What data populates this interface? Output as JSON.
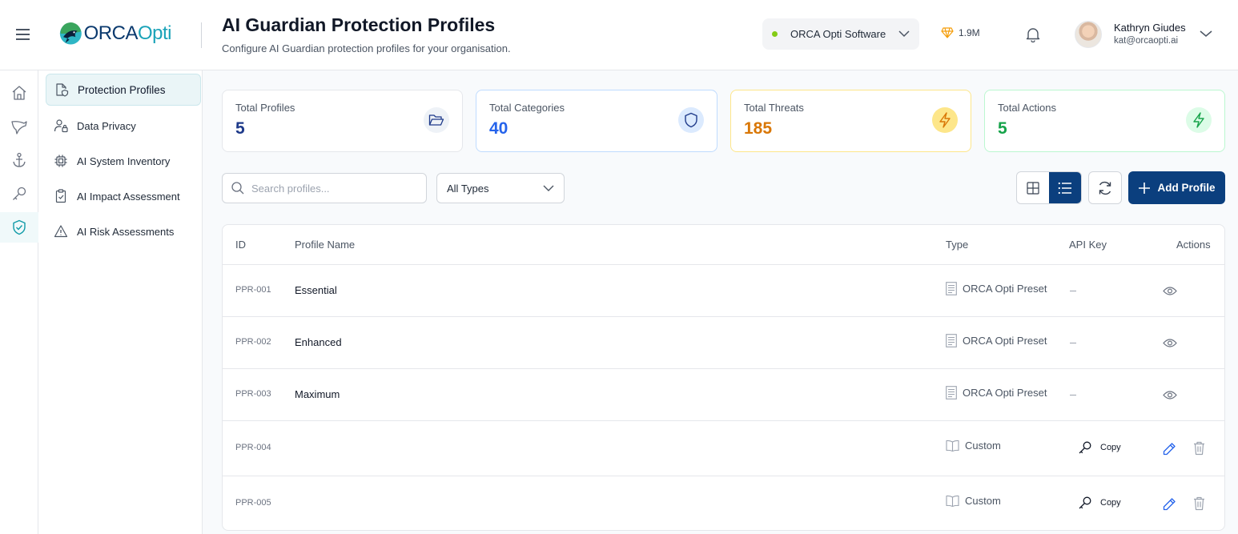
{
  "header": {
    "logo": {
      "part1": "ORCA",
      "part2": "Opti"
    },
    "title": "AI Guardian Protection Profiles",
    "subtitle": "Configure AI Guardian protection profiles for your organisation.",
    "org": {
      "name": "ORCA Opti Software",
      "status_color": "#84cc16"
    },
    "credits": "1.9M",
    "user": {
      "name": "Kathryn Giudes",
      "email": "kat@orcaopti.ai"
    }
  },
  "rail": {
    "items": [
      {
        "icon": "home-icon"
      },
      {
        "icon": "orca-icon"
      },
      {
        "icon": "anchor-icon"
      },
      {
        "icon": "key-icon"
      },
      {
        "icon": "shield-check-icon",
        "active": true
      }
    ]
  },
  "sidenav": {
    "items": [
      {
        "label": "Protection Profiles",
        "icon": "file-shield-icon",
        "active": true
      },
      {
        "label": "Data Privacy",
        "icon": "user-lock-icon"
      },
      {
        "label": "AI System Inventory",
        "icon": "chip-icon"
      },
      {
        "label": "AI Impact Assessment",
        "icon": "clipboard-check-icon"
      },
      {
        "label": "AI Risk Assessments",
        "icon": "warning-icon"
      }
    ]
  },
  "stats": [
    {
      "label": "Total Profiles",
      "value": "5",
      "color": "#1e3a8a",
      "icon": "folder-open-icon"
    },
    {
      "label": "Total Categories",
      "value": "40",
      "color": "#2563eb",
      "icon": "shield-icon"
    },
    {
      "label": "Total Threats",
      "value": "185",
      "color": "#d97706",
      "icon": "bolt-icon"
    },
    {
      "label": "Total Actions",
      "value": "5",
      "color": "#16a34a",
      "icon": "bolt-icon"
    }
  ],
  "toolbar": {
    "search_placeholder": "Search profiles...",
    "type_filter": "All Types",
    "add_label": "Add Profile"
  },
  "table": {
    "columns": {
      "id": "ID",
      "name": "Profile Name",
      "type": "Type",
      "api_key": "API Key",
      "actions": "Actions"
    },
    "rows": [
      {
        "id": "PPR-001",
        "name": "Essential",
        "type": "ORCA Opti Preset",
        "api_key": "",
        "editable": false
      },
      {
        "id": "PPR-002",
        "name": "Enhanced",
        "type": "ORCA Opti Preset",
        "api_key": "",
        "editable": false
      },
      {
        "id": "PPR-003",
        "name": "Maximum",
        "type": "ORCA Opti Preset",
        "api_key": "",
        "editable": false
      },
      {
        "id": "PPR-004",
        "name": "",
        "type": "Custom",
        "api_key": "Copy",
        "editable": true
      },
      {
        "id": "PPR-005",
        "name": "",
        "type": "Custom",
        "api_key": "Copy",
        "editable": true
      }
    ]
  }
}
